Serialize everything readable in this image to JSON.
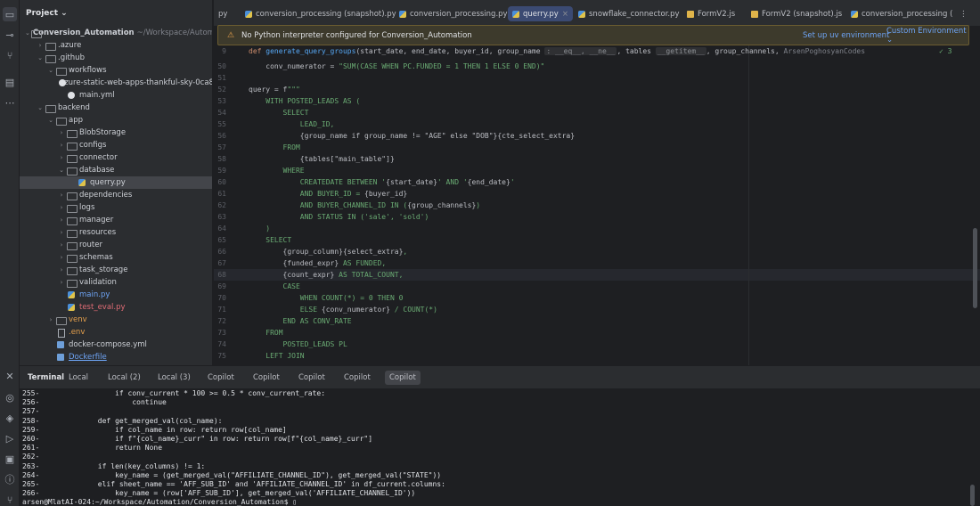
{
  "project": {
    "header": "Project ⌄",
    "tree": [
      {
        "name": "Conversion_Automation",
        "suffix": "~/Workspace/Automation...",
        "type": "folder",
        "level": 0,
        "open": true,
        "bold": true
      },
      {
        "name": ".azure",
        "type": "folder",
        "level": 1,
        "open": false
      },
      {
        "name": ".github",
        "type": "folder",
        "level": 1,
        "open": true
      },
      {
        "name": "workflows",
        "type": "folder",
        "level": 2,
        "open": true
      },
      {
        "name": "azure-static-web-apps-thankful-sky-0ca8",
        "type": "gh",
        "level": 3
      },
      {
        "name": "main.yml",
        "type": "gh",
        "level": 3
      },
      {
        "name": "backend",
        "type": "folder",
        "level": 1,
        "open": true
      },
      {
        "name": "app",
        "type": "folder",
        "level": 2,
        "open": true
      },
      {
        "name": "BlobStorage",
        "type": "folder",
        "level": 3,
        "open": false
      },
      {
        "name": "configs",
        "type": "folder",
        "level": 3,
        "open": false
      },
      {
        "name": "connector",
        "type": "folder",
        "level": 3,
        "open": false
      },
      {
        "name": "database",
        "type": "folder",
        "level": 3,
        "open": true
      },
      {
        "name": "querry.py",
        "type": "py",
        "level": 4,
        "selected": true
      },
      {
        "name": "dependencies",
        "type": "folder",
        "level": 3,
        "open": false
      },
      {
        "name": "logs",
        "type": "folder",
        "level": 3,
        "open": false
      },
      {
        "name": "manager",
        "type": "folder",
        "level": 3,
        "open": false
      },
      {
        "name": "resources",
        "type": "folder",
        "level": 3,
        "open": false
      },
      {
        "name": "router",
        "type": "folder",
        "level": 3,
        "open": false
      },
      {
        "name": "schemas",
        "type": "folder",
        "level": 3,
        "open": false
      },
      {
        "name": "task_storage",
        "type": "folder",
        "level": 3,
        "open": false
      },
      {
        "name": "validation",
        "type": "folder",
        "level": 3,
        "open": false
      },
      {
        "name": "main.py",
        "type": "py",
        "level": 3,
        "color": "blue"
      },
      {
        "name": "test_eval.py",
        "type": "py",
        "level": 3,
        "color": "red"
      },
      {
        "name": "venv",
        "type": "folder",
        "level": 2,
        "open": false,
        "color": "orange"
      },
      {
        "name": ".env",
        "type": "env",
        "level": 2,
        "color": "orange"
      },
      {
        "name": "docker-compose.yml",
        "type": "yml",
        "level": 2
      },
      {
        "name": "Dockerfile",
        "type": "yml",
        "level": 2,
        "color": "link"
      }
    ]
  },
  "tabs": [
    {
      "label": "py",
      "icon": "",
      "active": false
    },
    {
      "label": "conversion_processing (snapshot).py",
      "icon": "py",
      "active": false
    },
    {
      "label": "conversion_processing.py",
      "icon": "py",
      "active": false
    },
    {
      "label": "querry.py",
      "icon": "py",
      "active": true
    },
    {
      "label": "snowflake_connector.py",
      "icon": "py",
      "active": false
    },
    {
      "label": "FormV2.js",
      "icon": "js",
      "active": false
    },
    {
      "label": "FormV2 (snapshot).js",
      "icon": "js",
      "active": false
    },
    {
      "label": "conversion_processing (",
      "icon": "py",
      "active": false
    }
  ],
  "tab_menu": "⋮",
  "banner": {
    "text": "No Python interpreter configured for Conversion_Automation",
    "setup": "Set up uv environment",
    "custom": "Custom Environment ⌄"
  },
  "editor": {
    "sticky": {
      "num": "9",
      "def_kw": "def",
      "fn": "generate_query_groups",
      "params_a": "(start_date, end_date, buyer_id, group_name",
      "hint_a": ": __eq__, __ne__",
      "params_b": ", tables",
      "hint_b": "__getitem__",
      "params_c": ", group_channels,",
      "author": "ArsenPoghosyanCodes",
      "check": "✓ 3"
    },
    "lines": [
      {
        "num": "50",
        "segs": [
          {
            "t": "    conv_numerator = ",
            "c": ""
          },
          {
            "t": "\"SUM(CASE WHEN PC.FUNDED = 1 THEN 1 ELSE 0 END)\"",
            "c": "str"
          }
        ]
      },
      {
        "num": "51",
        "segs": []
      },
      {
        "num": "52",
        "segs": [
          {
            "t": "query = f",
            "c": ""
          },
          {
            "t": "\"\"\"",
            "c": "str"
          }
        ]
      },
      {
        "num": "53",
        "segs": [
          {
            "t": "    WITH POSTED_LEADS AS (",
            "c": "str"
          }
        ]
      },
      {
        "num": "54",
        "segs": [
          {
            "t": "        SELECT",
            "c": "str"
          }
        ]
      },
      {
        "num": "55",
        "segs": [
          {
            "t": "            LEAD_ID,",
            "c": "str"
          }
        ]
      },
      {
        "num": "56",
        "segs": [
          {
            "t": "            ",
            "c": "str"
          },
          {
            "t": "{group_name if group_name != \"AGE\" else \"DOB\"}{cte_select_extra}",
            "c": ""
          }
        ]
      },
      {
        "num": "57",
        "segs": [
          {
            "t": "        FROM",
            "c": "str"
          }
        ]
      },
      {
        "num": "58",
        "segs": [
          {
            "t": "            ",
            "c": "str"
          },
          {
            "t": "{tables[\"main_table\"]}",
            "c": ""
          }
        ]
      },
      {
        "num": "59",
        "segs": [
          {
            "t": "        WHERE",
            "c": "str"
          }
        ]
      },
      {
        "num": "60",
        "segs": [
          {
            "t": "            CREATEDATE BETWEEN '",
            "c": "str"
          },
          {
            "t": "{start_date}",
            "c": ""
          },
          {
            "t": "' AND '",
            "c": "str"
          },
          {
            "t": "{end_date}",
            "c": ""
          },
          {
            "t": "'",
            "c": "str"
          }
        ]
      },
      {
        "num": "61",
        "segs": [
          {
            "t": "            AND BUYER_ID = ",
            "c": "str"
          },
          {
            "t": "{buyer_id}",
            "c": ""
          }
        ]
      },
      {
        "num": "62",
        "segs": [
          {
            "t": "            AND BUYER_CHANNEL_ID IN (",
            "c": "str"
          },
          {
            "t": "{group_channels}",
            "c": ""
          },
          {
            "t": ")",
            "c": "str"
          }
        ]
      },
      {
        "num": "63",
        "segs": [
          {
            "t": "            AND STATUS IN ('sale', 'sold')",
            "c": "str"
          }
        ]
      },
      {
        "num": "64",
        "segs": [
          {
            "t": "    )",
            "c": "str"
          }
        ]
      },
      {
        "num": "65",
        "segs": [
          {
            "t": "    SELECT",
            "c": "str"
          }
        ]
      },
      {
        "num": "66",
        "segs": [
          {
            "t": "        ",
            "c": "str"
          },
          {
            "t": "{group_column}{select_extra}",
            "c": ""
          },
          {
            "t": ",",
            "c": "str"
          }
        ]
      },
      {
        "num": "67",
        "segs": [
          {
            "t": "        ",
            "c": "str"
          },
          {
            "t": "{funded_expr}",
            "c": ""
          },
          {
            "t": " AS FUNDED,",
            "c": "str"
          }
        ]
      },
      {
        "num": "68",
        "segs": [
          {
            "t": "        ",
            "c": "str"
          },
          {
            "t": "{count_expr}",
            "c": ""
          },
          {
            "t": " AS TOTAL_COUNT,",
            "c": "str"
          }
        ]
      },
      {
        "num": "69",
        "segs": [
          {
            "t": "        CASE",
            "c": "str"
          }
        ]
      },
      {
        "num": "70",
        "segs": [
          {
            "t": "            WHEN COUNT(*) = 0 THEN 0",
            "c": "str"
          }
        ]
      },
      {
        "num": "71",
        "segs": [
          {
            "t": "            ELSE ",
            "c": "str"
          },
          {
            "t": "{conv_numerator}",
            "c": ""
          },
          {
            "t": " / COUNT(*)",
            "c": "str"
          }
        ]
      },
      {
        "num": "72",
        "segs": [
          {
            "t": "        END AS CONV_RATE",
            "c": "str"
          }
        ]
      },
      {
        "num": "73",
        "segs": [
          {
            "t": "    FROM",
            "c": "str"
          }
        ]
      },
      {
        "num": "74",
        "segs": [
          {
            "t": "        POSTED_LEADS PL",
            "c": "str"
          }
        ]
      },
      {
        "num": "75",
        "segs": [
          {
            "t": "    LEFT JOIN",
            "c": "str"
          }
        ]
      }
    ]
  },
  "terminal_tabs": [
    {
      "label": "Terminal",
      "title": true
    },
    {
      "label": "Local"
    },
    {
      "label": "Local (2)"
    },
    {
      "label": "Local (3)"
    },
    {
      "label": "Copilot"
    },
    {
      "label": "Copilot"
    },
    {
      "label": "Copilot"
    },
    {
      "label": "Copilot"
    },
    {
      "label": "Copilot",
      "active": true
    }
  ],
  "terminal": [
    {
      "num": "255-",
      "text": "                if conv_current * 100 >= 0.5 * conv_current_rate:"
    },
    {
      "num": "256-",
      "text": "                    continue"
    },
    {
      "num": "257-",
      "text": ""
    },
    {
      "num": "258-",
      "text": "            def get_merged_val(col_name):"
    },
    {
      "num": "259-",
      "text": "                if col_name in row: return row[col_name]"
    },
    {
      "num": "260-",
      "text": "                if f\"{col_name}_curr\" in row: return row[f\"{col_name}_curr\"]"
    },
    {
      "num": "261-",
      "text": "                return None"
    },
    {
      "num": "262-",
      "text": ""
    },
    {
      "num": "263-",
      "text": "            if len(key_columns) != 1:"
    },
    {
      "num": "264-",
      "text": "                key_name = (get_merged_val(\"AFFILIATE_CHANNEL_ID\"), get_merged_val(\"STATE\"))"
    },
    {
      "num": "265-",
      "text": "            elif sheet_name == 'AFF_SUB_ID' and 'AFFILIATE_CHANNEL_ID' in df_current.columns:"
    },
    {
      "num": "266-",
      "text": "                key_name = (row['AFF_SUB_ID'], get_merged_val('AFFILIATE_CHANNEL_ID'))"
    }
  ],
  "terminal_prompt": "arsen@MlatAI-024:~/Workspace/Automation/Conversion_Automation$ ▯"
}
